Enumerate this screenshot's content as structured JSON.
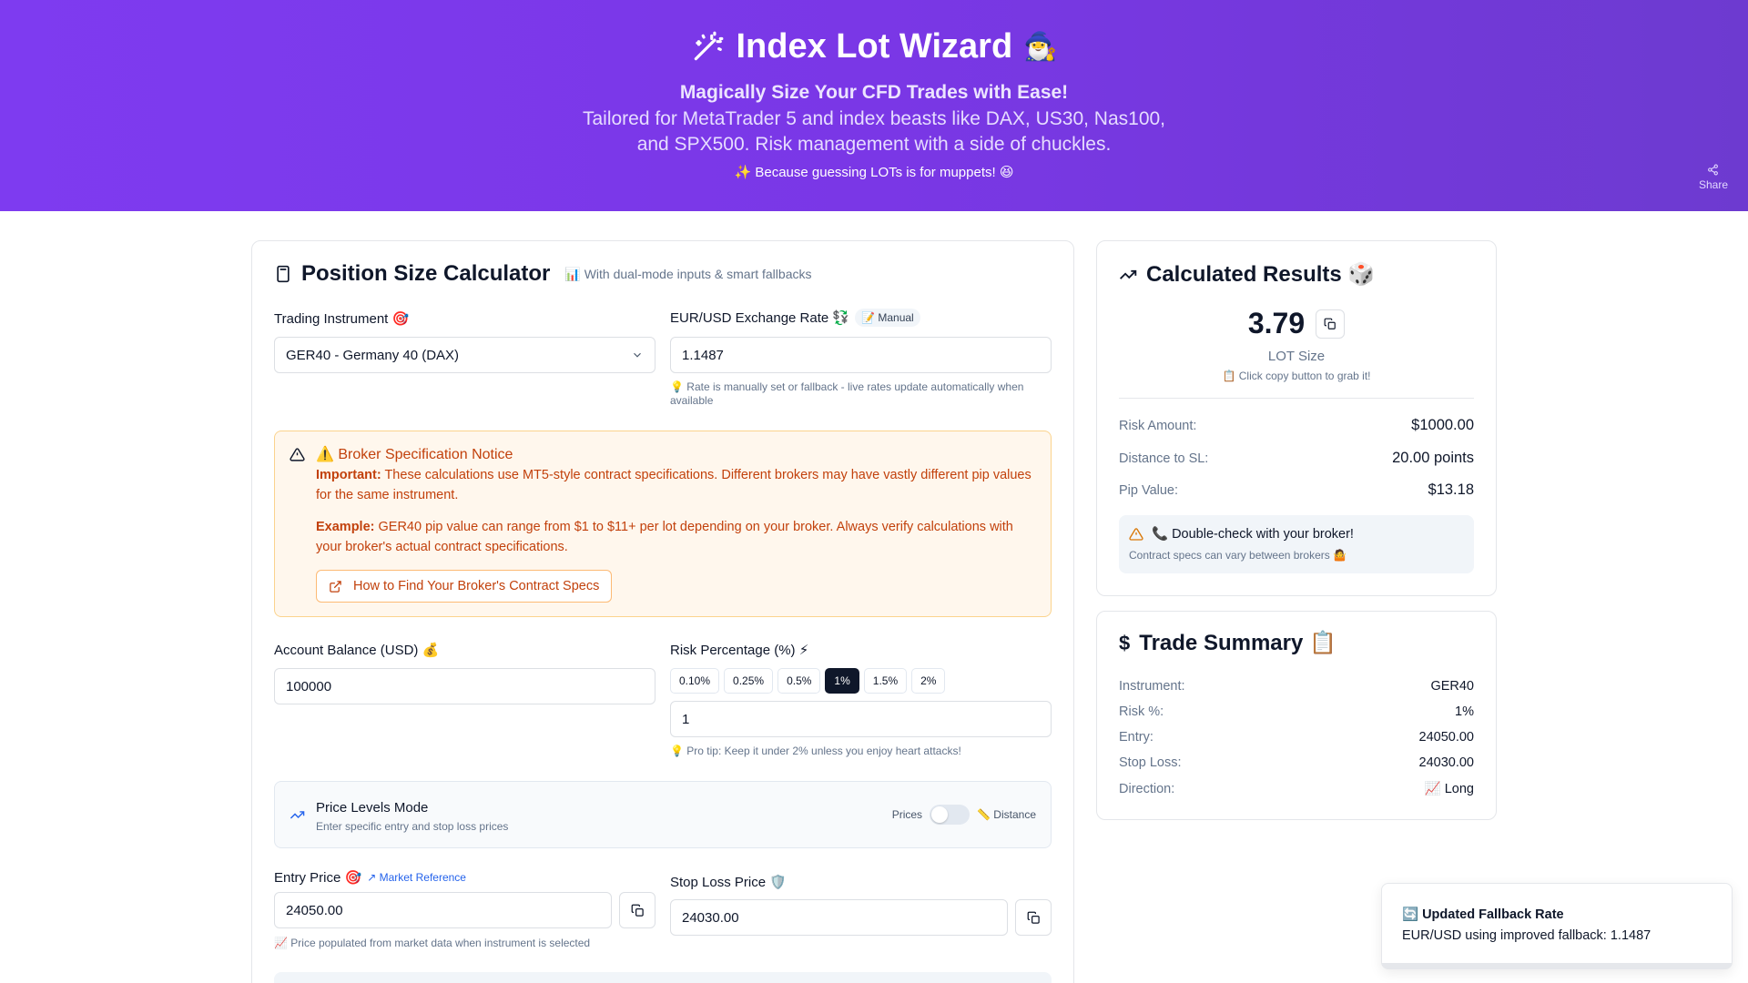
{
  "hero": {
    "title": "Index Lot Wizard",
    "wizard_emoji": "🧙‍♂️",
    "subtitle": "Magically Size Your CFD Trades with Ease!",
    "description": "Tailored for MetaTrader 5 and index beasts like DAX, US30, Nas100, and SPX500. Risk management with a side of chuckles.",
    "tagline": "✨ Because guessing LOTs is for muppets! 😆",
    "share_label": "Share"
  },
  "calculator": {
    "title": "Position Size Calculator",
    "subtitle": "📊 With dual-mode inputs & smart fallbacks",
    "instrument_label": "Trading Instrument 🎯",
    "instrument_value": "GER40 - Germany 40 (DAX)",
    "rate_label": "EUR/USD Exchange Rate 💱",
    "rate_badge": "📝 Manual",
    "rate_value": "1.1487",
    "rate_hint": "💡 Rate is manually set or fallback - live rates update automatically when available",
    "notice": {
      "title": "⚠️ Broker Specification Notice",
      "important_label": "Important:",
      "important_text": " These calculations use MT5-style contract specifications. Different brokers may have vastly different pip values for the same instrument.",
      "example_label": "Example:",
      "example_text": " GER40 pip value can range from $1 to $11+ per lot depending on your broker. Always verify calculations with your broker's actual contract specifications.",
      "button_label": "How to Find Your Broker's Contract Specs"
    },
    "balance_label": "Account Balance (USD) 💰",
    "balance_value": "100000",
    "risk_label": "Risk Percentage (%) ⚡",
    "risk_chips": [
      "0.10%",
      "0.25%",
      "0.5%",
      "1%",
      "1.5%",
      "2%"
    ],
    "risk_active": "1%",
    "risk_value": "1",
    "risk_hint": "💡 Pro tip: Keep it under 2% unless you enjoy heart attacks!",
    "mode": {
      "title": "Price Levels Mode",
      "desc": "Enter specific entry and stop loss prices",
      "left_label": "Prices",
      "right_label": "📏 Distance"
    },
    "entry_label": "Entry Price 🎯",
    "market_ref": "↗ Market Reference",
    "entry_value": "24050.00",
    "entry_hint": "📈 Price populated from market data when instrument is selected",
    "sl_label": "Stop Loss Price 🛡️",
    "sl_value": "24030.00"
  },
  "results": {
    "title": "Calculated Results 🎲",
    "lot_value": "3.79",
    "lot_label": "LOT Size",
    "lot_hint": "📋 Click copy button to grab it!",
    "rows": [
      {
        "label": "Risk Amount:",
        "value": "$1000.00"
      },
      {
        "label": "Distance to SL:",
        "value": "20.00 points"
      },
      {
        "label": "Pip Value:",
        "value": "$13.18"
      }
    ],
    "warn_title": "📞 Double-check with your broker!",
    "warn_text": "Contract specs can vary between brokers 🤷"
  },
  "summary": {
    "title": "Trade Summary 📋",
    "rows": [
      {
        "label": "Instrument:",
        "value": "GER40"
      },
      {
        "label": "Risk %:",
        "value": "1%"
      },
      {
        "label": "Entry:",
        "value": "24050.00"
      },
      {
        "label": "Stop Loss:",
        "value": "24030.00"
      },
      {
        "label": "Direction:",
        "value": "📈 Long"
      }
    ]
  },
  "toast": {
    "title": "🔄 Updated Fallback Rate",
    "text": "EUR/USD using improved fallback: 1.1487"
  }
}
